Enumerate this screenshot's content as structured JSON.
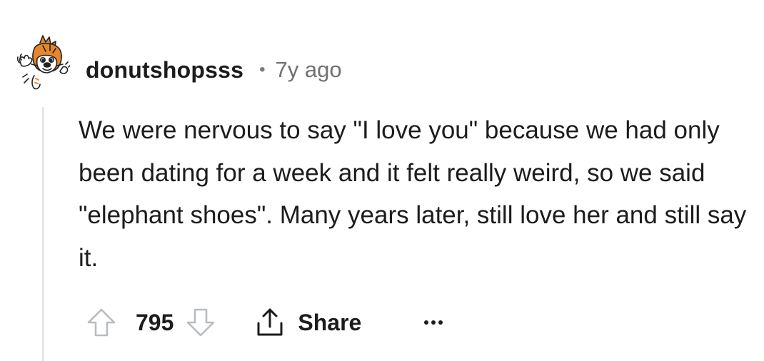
{
  "comment": {
    "username": "donutshopsss",
    "separator": "•",
    "timestamp": "7y ago",
    "body": "We were nervous to say \"I love you\" because we had only been dating for a week and it felt really weird, so we said \"elephant shoes\". Many years later, still love her and still say it.",
    "score": "795",
    "share_label": "Share",
    "more_label": "..."
  },
  "icons": {
    "avatar": "cartoon-tiger-avatar",
    "upvote": "upvote-arrow-icon",
    "downvote": "downvote-arrow-icon",
    "share": "share-icon",
    "more": "more-options-icon"
  },
  "colors": {
    "text": "#1c1c1c",
    "meta": "#6f7173",
    "thread_line": "#e3e6e8",
    "icon_gray": "#b8bcbf",
    "avatar_orange": "#e8862a"
  }
}
